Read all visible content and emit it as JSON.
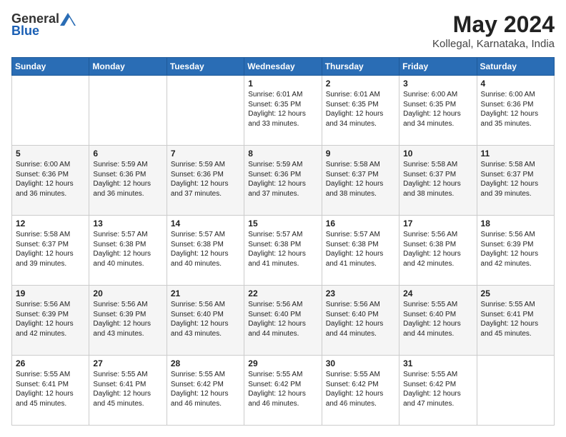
{
  "header": {
    "logo_general": "General",
    "logo_blue": "Blue",
    "title": "May 2024",
    "subtitle": "Kollegal, Karnataka, India"
  },
  "weekdays": [
    "Sunday",
    "Monday",
    "Tuesday",
    "Wednesday",
    "Thursday",
    "Friday",
    "Saturday"
  ],
  "weeks": [
    [
      {
        "day": "",
        "info": ""
      },
      {
        "day": "",
        "info": ""
      },
      {
        "day": "",
        "info": ""
      },
      {
        "day": "1",
        "info": "Sunrise: 6:01 AM\nSunset: 6:35 PM\nDaylight: 12 hours\nand 33 minutes."
      },
      {
        "day": "2",
        "info": "Sunrise: 6:01 AM\nSunset: 6:35 PM\nDaylight: 12 hours\nand 34 minutes."
      },
      {
        "day": "3",
        "info": "Sunrise: 6:00 AM\nSunset: 6:35 PM\nDaylight: 12 hours\nand 34 minutes."
      },
      {
        "day": "4",
        "info": "Sunrise: 6:00 AM\nSunset: 6:36 PM\nDaylight: 12 hours\nand 35 minutes."
      }
    ],
    [
      {
        "day": "5",
        "info": "Sunrise: 6:00 AM\nSunset: 6:36 PM\nDaylight: 12 hours\nand 36 minutes."
      },
      {
        "day": "6",
        "info": "Sunrise: 5:59 AM\nSunset: 6:36 PM\nDaylight: 12 hours\nand 36 minutes."
      },
      {
        "day": "7",
        "info": "Sunrise: 5:59 AM\nSunset: 6:36 PM\nDaylight: 12 hours\nand 37 minutes."
      },
      {
        "day": "8",
        "info": "Sunrise: 5:59 AM\nSunset: 6:36 PM\nDaylight: 12 hours\nand 37 minutes."
      },
      {
        "day": "9",
        "info": "Sunrise: 5:58 AM\nSunset: 6:37 PM\nDaylight: 12 hours\nand 38 minutes."
      },
      {
        "day": "10",
        "info": "Sunrise: 5:58 AM\nSunset: 6:37 PM\nDaylight: 12 hours\nand 38 minutes."
      },
      {
        "day": "11",
        "info": "Sunrise: 5:58 AM\nSunset: 6:37 PM\nDaylight: 12 hours\nand 39 minutes."
      }
    ],
    [
      {
        "day": "12",
        "info": "Sunrise: 5:58 AM\nSunset: 6:37 PM\nDaylight: 12 hours\nand 39 minutes."
      },
      {
        "day": "13",
        "info": "Sunrise: 5:57 AM\nSunset: 6:38 PM\nDaylight: 12 hours\nand 40 minutes."
      },
      {
        "day": "14",
        "info": "Sunrise: 5:57 AM\nSunset: 6:38 PM\nDaylight: 12 hours\nand 40 minutes."
      },
      {
        "day": "15",
        "info": "Sunrise: 5:57 AM\nSunset: 6:38 PM\nDaylight: 12 hours\nand 41 minutes."
      },
      {
        "day": "16",
        "info": "Sunrise: 5:57 AM\nSunset: 6:38 PM\nDaylight: 12 hours\nand 41 minutes."
      },
      {
        "day": "17",
        "info": "Sunrise: 5:56 AM\nSunset: 6:38 PM\nDaylight: 12 hours\nand 42 minutes."
      },
      {
        "day": "18",
        "info": "Sunrise: 5:56 AM\nSunset: 6:39 PM\nDaylight: 12 hours\nand 42 minutes."
      }
    ],
    [
      {
        "day": "19",
        "info": "Sunrise: 5:56 AM\nSunset: 6:39 PM\nDaylight: 12 hours\nand 42 minutes."
      },
      {
        "day": "20",
        "info": "Sunrise: 5:56 AM\nSunset: 6:39 PM\nDaylight: 12 hours\nand 43 minutes."
      },
      {
        "day": "21",
        "info": "Sunrise: 5:56 AM\nSunset: 6:40 PM\nDaylight: 12 hours\nand 43 minutes."
      },
      {
        "day": "22",
        "info": "Sunrise: 5:56 AM\nSunset: 6:40 PM\nDaylight: 12 hours\nand 44 minutes."
      },
      {
        "day": "23",
        "info": "Sunrise: 5:56 AM\nSunset: 6:40 PM\nDaylight: 12 hours\nand 44 minutes."
      },
      {
        "day": "24",
        "info": "Sunrise: 5:55 AM\nSunset: 6:40 PM\nDaylight: 12 hours\nand 44 minutes."
      },
      {
        "day": "25",
        "info": "Sunrise: 5:55 AM\nSunset: 6:41 PM\nDaylight: 12 hours\nand 45 minutes."
      }
    ],
    [
      {
        "day": "26",
        "info": "Sunrise: 5:55 AM\nSunset: 6:41 PM\nDaylight: 12 hours\nand 45 minutes."
      },
      {
        "day": "27",
        "info": "Sunrise: 5:55 AM\nSunset: 6:41 PM\nDaylight: 12 hours\nand 45 minutes."
      },
      {
        "day": "28",
        "info": "Sunrise: 5:55 AM\nSunset: 6:42 PM\nDaylight: 12 hours\nand 46 minutes."
      },
      {
        "day": "29",
        "info": "Sunrise: 5:55 AM\nSunset: 6:42 PM\nDaylight: 12 hours\nand 46 minutes."
      },
      {
        "day": "30",
        "info": "Sunrise: 5:55 AM\nSunset: 6:42 PM\nDaylight: 12 hours\nand 46 minutes."
      },
      {
        "day": "31",
        "info": "Sunrise: 5:55 AM\nSunset: 6:42 PM\nDaylight: 12 hours\nand 47 minutes."
      },
      {
        "day": "",
        "info": ""
      }
    ]
  ]
}
